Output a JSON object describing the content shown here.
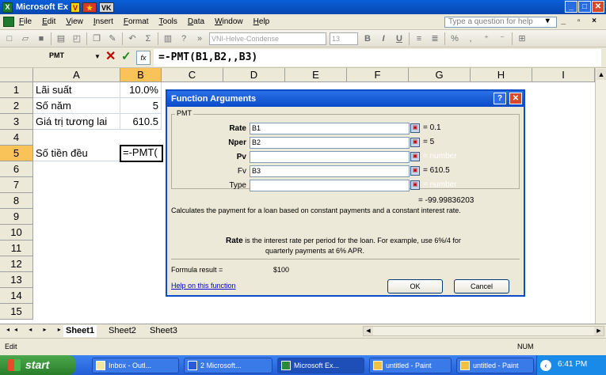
{
  "window": {
    "title": "Microsoft Ex",
    "tag_v": "V",
    "tag_vk": "VK",
    "min_label": "_",
    "max_label": "□",
    "close_label": "✕"
  },
  "menu": {
    "items": [
      "File",
      "Edit",
      "View",
      "Insert",
      "Format",
      "Tools",
      "Data",
      "Window",
      "Help"
    ],
    "help_placeholder": "Type a question for help",
    "right_controls": "▾ _ ▫ ×"
  },
  "toolbar": {
    "font_name": "VNI-Helve-Condense",
    "font_size": "13",
    "bold": "B",
    "italic": "I",
    "underline": "U",
    "percent": "%"
  },
  "formula_bar": {
    "name_box": "PMT",
    "formula": "=-PMT(B1,B2,,B3)"
  },
  "grid": {
    "columns": [
      "A",
      "B",
      "C",
      "D",
      "E",
      "F",
      "G",
      "H",
      "I"
    ],
    "rows": [
      "1",
      "2",
      "3",
      "4",
      "5",
      "6",
      "7",
      "8",
      "9",
      "10",
      "11",
      "12",
      "13",
      "14",
      "15"
    ],
    "cells": {
      "A1": "Lãi suất",
      "B1": "10.0%",
      "A2": "Số năm",
      "B2": "5",
      "A3": "Giá trị tương lai",
      "B3": "610.5",
      "A5": "Số tiền đều",
      "B5": "=-PMT("
    }
  },
  "dialog": {
    "title": "Function Arguments",
    "help_label": "?",
    "close_label": "✕",
    "function_name": "PMT",
    "args": [
      {
        "label": "Rate",
        "value": "B1",
        "result": "= 0.1"
      },
      {
        "label": "Nper",
        "value": "B2",
        "result": "= 5"
      },
      {
        "label": "Pv",
        "value": "",
        "result": "= number"
      },
      {
        "label": "Fv",
        "value": "B3",
        "result": "= 610.5"
      },
      {
        "label": "Type",
        "value": "",
        "result": "= number"
      }
    ],
    "overall_result": "= -99.99836203",
    "description": "Calculates the payment for a loan based on constant payments and a constant interest rate.",
    "arg_desc_name": "Rate",
    "arg_desc_line1": "is the interest rate per period for the loan. For example, use 6%/4 for",
    "arg_desc_line2": "quarterly payments at 6% APR.",
    "formula_result_label": "Formula result =",
    "formula_result_value": "$100",
    "help_link": "Help on this function",
    "ok_label": "OK",
    "cancel_label": "Cancel"
  },
  "sheets": {
    "nav": "◂◂ ◂ ▸ ▸▸",
    "tabs": [
      "Sheet1",
      "Sheet2",
      "Sheet3"
    ]
  },
  "status": {
    "mode": "Edit",
    "num": "NUM"
  },
  "taskbar": {
    "start_label": "start",
    "buttons": [
      "Inbox - Outl...",
      "2 Microsoft...",
      "Microsoft Ex...",
      "untitled - Paint",
      "untitled - Paint"
    ],
    "clock": "6:41 PM"
  }
}
